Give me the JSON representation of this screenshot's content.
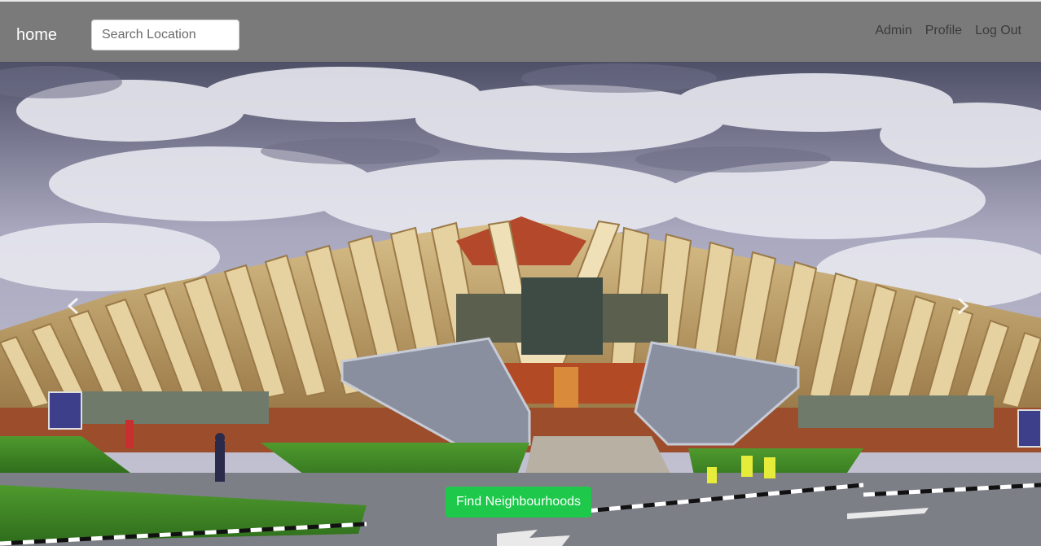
{
  "navbar": {
    "brand": "home",
    "search_placeholder": "Search Location",
    "links": [
      {
        "label": "Admin"
      },
      {
        "label": "Profile"
      },
      {
        "label": "Log Out"
      }
    ]
  },
  "carousel": {
    "prev_icon": "chevron-left-icon",
    "next_icon": "chevron-right-icon",
    "cta_label": "Find Neighbourhoods"
  },
  "colors": {
    "navbar_bg": "#7a7a7a",
    "cta_bg": "#1ec84b"
  }
}
